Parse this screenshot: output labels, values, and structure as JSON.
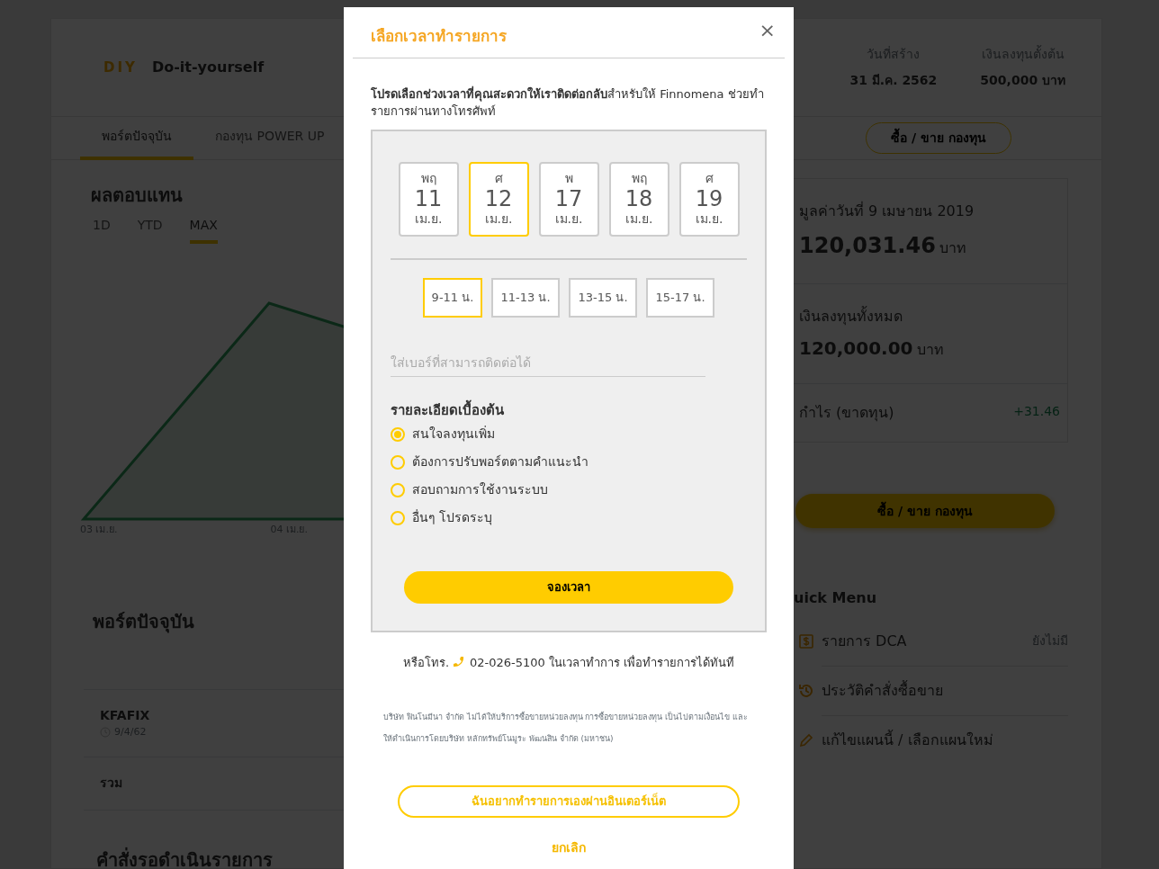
{
  "page": {
    "logo": "DIY",
    "title": "Do-it-yourself",
    "stats": [
      {
        "label": "วันที่สร้าง",
        "value": "31 มี.ค. 2562"
      },
      {
        "label": "เงินลงทุนตั้งต้น",
        "value": "500,000 บาท"
      }
    ],
    "tabs": [
      {
        "label": "พอร์ตปัจจุบัน",
        "selected": true
      },
      {
        "label": "กองทุน POWER UP",
        "selected": false
      }
    ],
    "trade_button": "ซื้อ / ขาย กองทุน",
    "returns": {
      "title": "ผลตอบแทน",
      "periods": [
        {
          "label": "1D",
          "selected": false
        },
        {
          "label": "YTD",
          "selected": false
        },
        {
          "label": "MAX",
          "selected": true
        }
      ],
      "x_labels": [
        "03 เม.ย.",
        "04 เม.ย."
      ]
    },
    "portfolio": {
      "title": "พอร์ตปัจจุบัน",
      "rows": [
        {
          "kind": "fund",
          "name": "KFAFIX",
          "date": "9/4/62"
        },
        {
          "kind": "total",
          "name": "รวม"
        }
      ]
    },
    "pending_title": "คำสั่งรอดำเนินรายการ",
    "summary": [
      {
        "label": "มูลค่าวันที่ 9 เมษายน 2019",
        "amount": "120,031.46",
        "unit": "บาท"
      },
      {
        "label": "เงินลงทุนทั้งหมด",
        "amount": "120,000.00",
        "unit": "บาท"
      },
      {
        "label": "กำไร (ขาดทุน)",
        "change": "+31.46"
      }
    ],
    "buy_sell_button": "ซื้อ / ขาย กองทุน",
    "quick_menu": {
      "title": "uick Menu",
      "items": [
        {
          "kind": "dca",
          "label": "รายการ DCA",
          "status": "ยังไม่มี"
        },
        {
          "kind": "history",
          "label": "ประวัติคำสั่งซื้อขาย"
        },
        {
          "kind": "edit",
          "label": "แก้ไขแผนนี้ / เลือกแผนใหม่"
        }
      ]
    }
  },
  "modal": {
    "title": "เลือกเวลาทำรายการ",
    "close": "×",
    "intro": "**โปรดเลือกช่วงเวลาที่คุณสะดวกให้เราติดต่อกลับ**สำหรับให้ Finnomena ช่วยทำรายการผ่านทางโทรศัพท์",
    "dates": [
      {
        "weekday": "พฤ",
        "day": "11",
        "month": "เม.ย.",
        "selected": false
      },
      {
        "weekday": "ศ",
        "day": "12",
        "month": "เม.ย.",
        "selected": true
      },
      {
        "weekday": "พ",
        "day": "17",
        "month": "เม.ย.",
        "selected": false
      },
      {
        "weekday": "พฤ",
        "day": "18",
        "month": "เม.ย.",
        "selected": false
      },
      {
        "weekday": "ศ",
        "day": "19",
        "month": "เม.ย.",
        "selected": false
      }
    ],
    "times": [
      {
        "label": "9-11 น.",
        "selected": true
      },
      {
        "label": "11-13 น.",
        "selected": false
      },
      {
        "label": "13-15 น.",
        "selected": false
      },
      {
        "label": "15-17 น.",
        "selected": false
      }
    ],
    "phone": {
      "placeholder": "ใส่เบอร์ที่สามารถติดต่อได้"
    },
    "details_title": "รายละเอียดเบื้องต้น",
    "reasons": [
      {
        "label": "สนใจลงทุนเพิ่ม",
        "selected": true
      },
      {
        "label": "ต้องการปรับพอร์ตตามคำแนะนำ",
        "selected": false
      },
      {
        "label": "สอบถามการใช้งานระบบ",
        "selected": false
      },
      {
        "label": "อื่นๆ โปรดระบุ",
        "selected": false
      }
    ],
    "book_button": "จองเวลา",
    "call_prefix": "หรือโทร.",
    "call_text": "02-026-5100 ในเวลาทำการ เพื่อทำรายการได้ทันที",
    "disclaimer": "บริษัท ฟินโนมีนา จำกัด ไม่ได้ให้บริการซื้อขายหน่วยลงทุน การซื้อขายหน่วยลงทุน เป็นไปตามเงื่อนไข และให้ดำเนินการโดยบริษัท หลักทรัพย์โนมูระ พัฒนสิน จำกัด (มหาชน)",
    "online_button": "ฉันอยากทำรายการเองผ่านอินเตอร์เน็ต",
    "cancel": "ยกเลิก"
  }
}
